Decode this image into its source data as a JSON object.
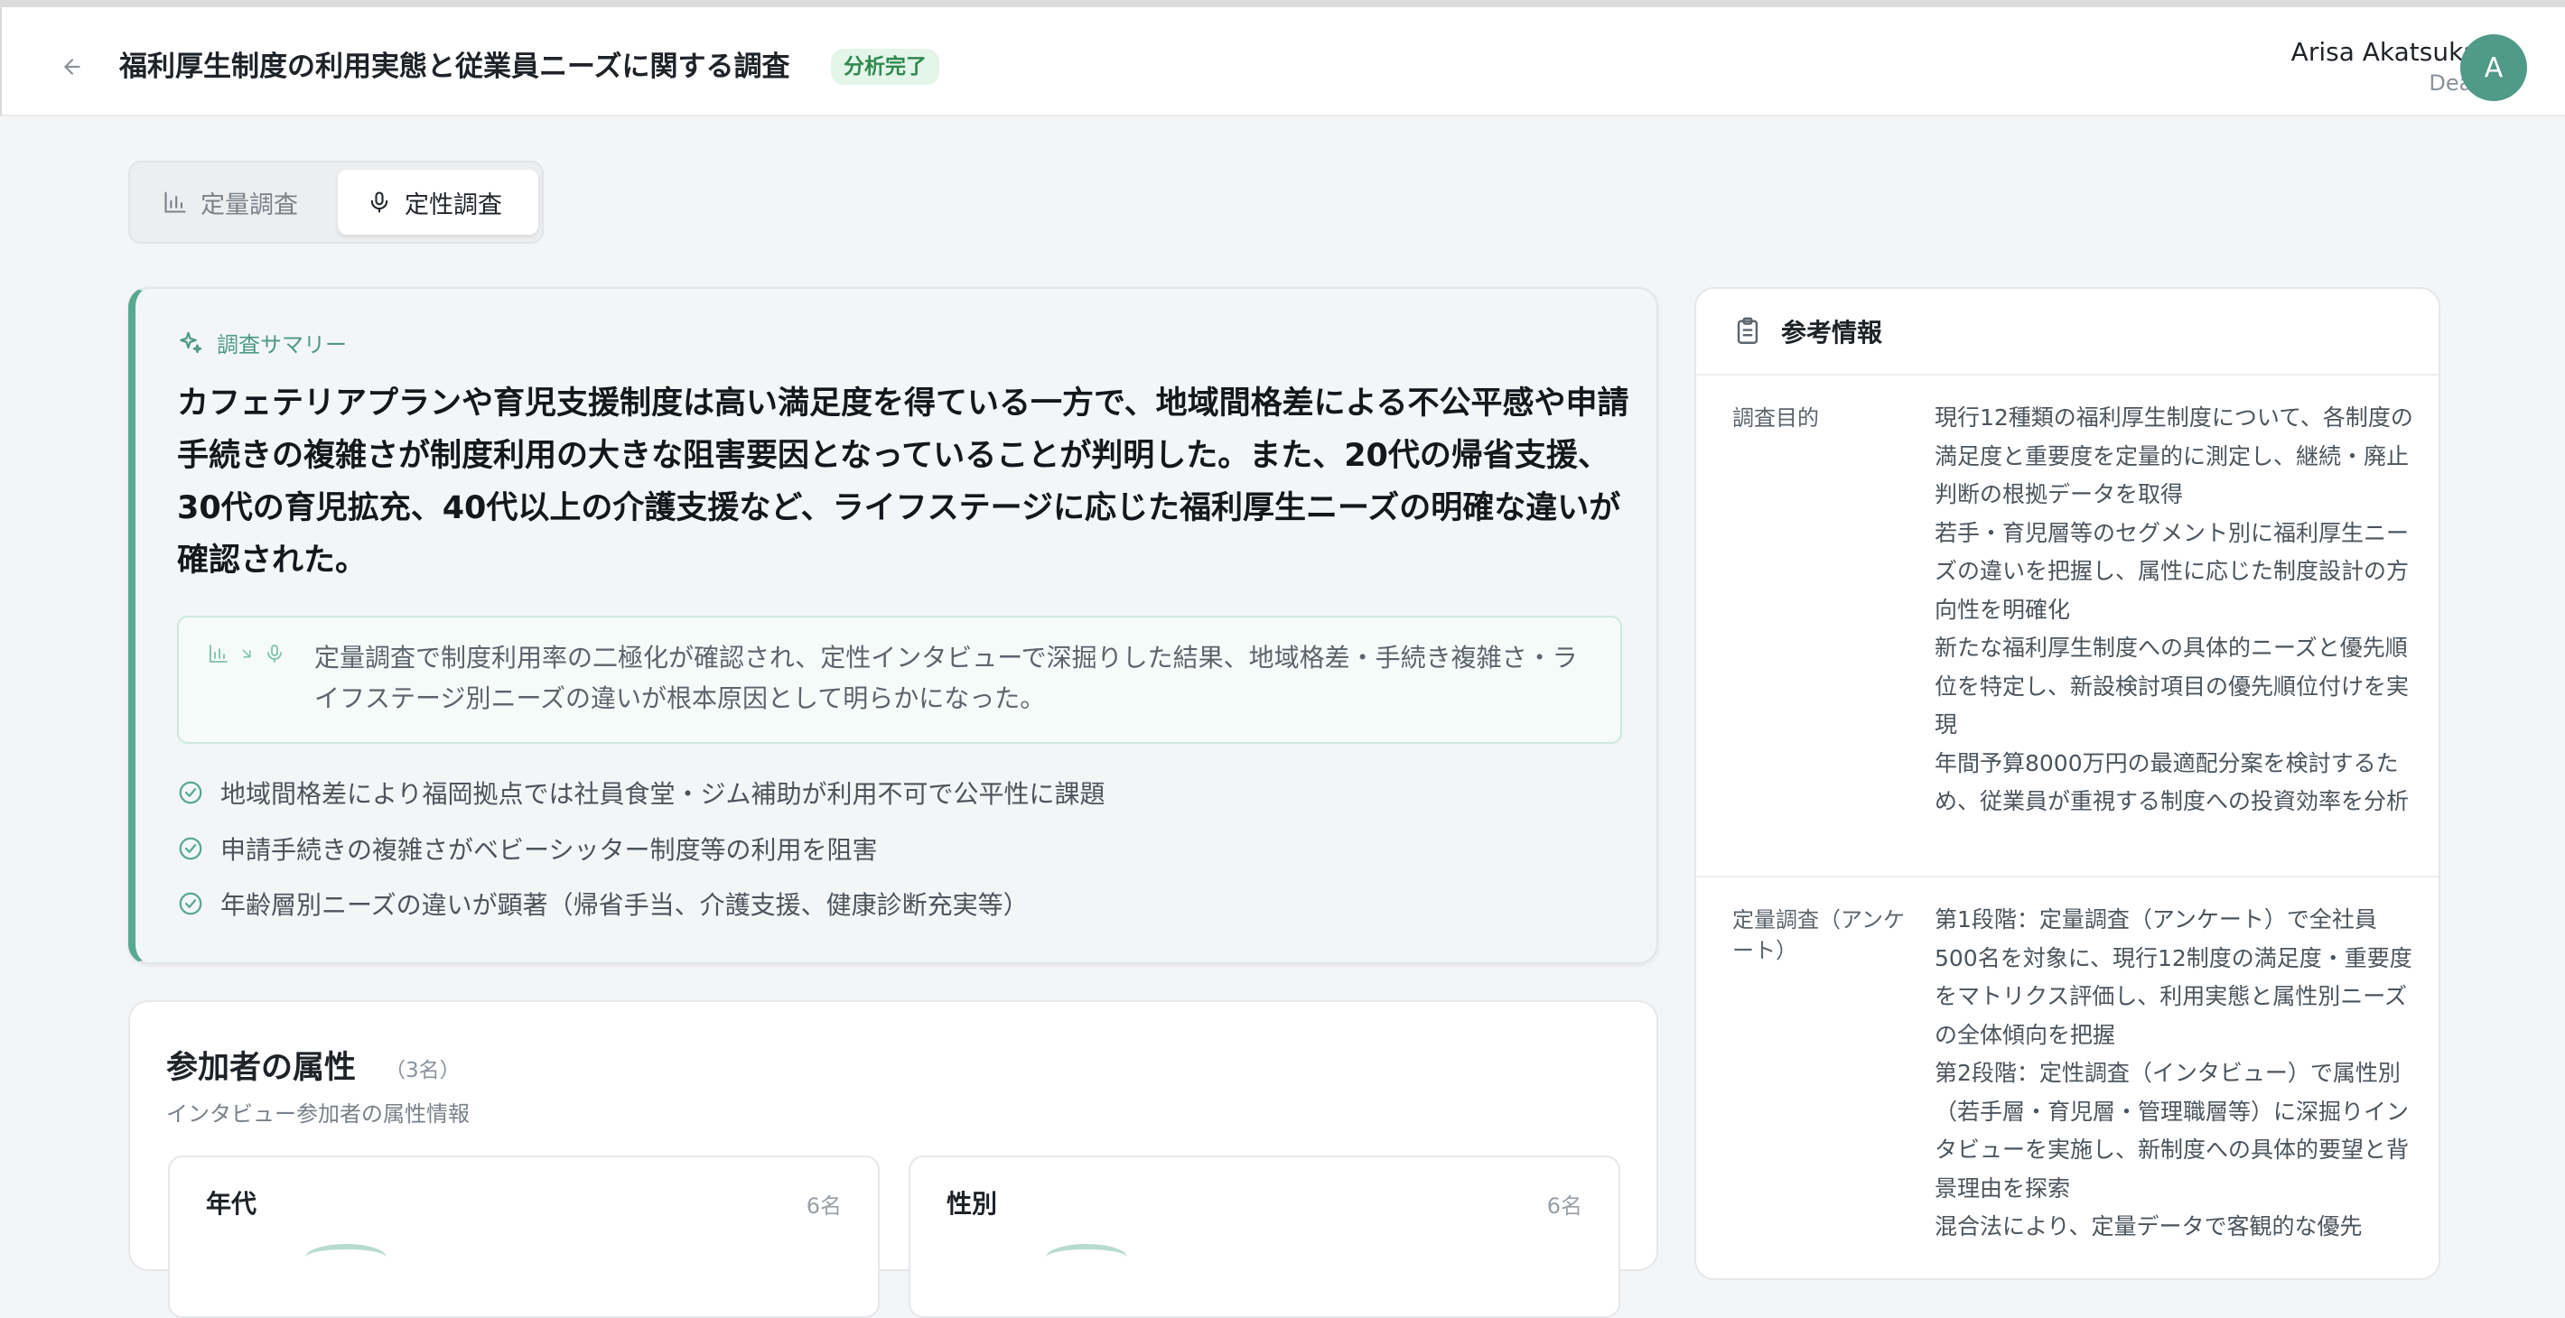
{
  "header": {
    "title": "福利厚生制度の利用実態と従業員ニーズに関する調査",
    "status": "分析完了",
    "user_name": "Arisa Akatsuka",
    "user_role": "Deal",
    "avatar_initial": "A",
    "back_icon": "arrow-left-icon"
  },
  "tabs": [
    {
      "label": "定量調査",
      "icon": "bar-chart-icon",
      "active": false
    },
    {
      "label": "定性調査",
      "icon": "microphone-icon",
      "active": true
    }
  ],
  "summary": {
    "label": "調査サマリー",
    "text": "カフェテリアプランや育児支援制度は高い満足度を得ている一方で、地域間格差による不公平感や申請手続きの複雑さが制度利用の大きな阻害要因となっていることが判明した。また、20代の帰省支援、30代の育児拡充、40代以上の介護支援など、ライフステージに応じた福利厚生ニーズの明確な違いが確認された。",
    "insight": "定量調査で制度利用率の二極化が確認され、定性インタビューで深掘りした結果、地域格差・手続き複雑さ・ライフステージ別ニーズの違いが根本原因として明らかになった。",
    "findings": [
      "地域間格差により福岡拠点では社員食堂・ジム補助が利用不可で公平性に課題",
      "申請手続きの複雑さがベビーシッター制度等の利用を阻害",
      "年齢層別ニーズの違いが顕著（帰省手当、介護支援、健康診断充実等）"
    ]
  },
  "attributes": {
    "title": "参加者の属性",
    "count": "（3名）",
    "subtitle": "インタビュー参加者の属性情報",
    "cards": [
      {
        "title": "年代",
        "count": "6名"
      },
      {
        "title": "性別",
        "count": "6名"
      }
    ]
  },
  "reference": {
    "title": "参考情報",
    "rows": [
      {
        "label": "調査目的",
        "values": [
          "現行12種類の福利厚生制度について、各制度の満足度と重要度を定量的に測定し、継続・廃止判断の根拠データを取得",
          "若手・育児層等のセグメント別に福利厚生ニーズの違いを把握し、属性に応じた制度設計の方向性を明確化",
          "新たな福利厚生制度への具体的ニーズと優先順位を特定し、新設検討項目の優先順位付けを実現",
          "年間予算8000万円の最適配分案を検討するため、従業員が重視する制度への投資効率を分析"
        ]
      },
      {
        "label": "定量調査（アンケート）",
        "values": [
          "第1段階：定量調査（アンケート）で全社員500名を対象に、現行12制度の満足度・重要度をマトリクス評価し、利用実態と属性別ニーズの全体傾向を把握",
          "第2段階：定性調査（インタビュー）で属性別（若手層・育児層・管理職層等）に深掘りインタビューを実施し、新制度への具体的要望と背景理由を探索",
          "混合法により、定量データで客観的な優先"
        ]
      }
    ]
  },
  "colors": {
    "accent": "#58a98f",
    "badge_bg": "#e4f5e9",
    "badge_text": "#2f8a4f",
    "avatar": "#4f9a88"
  }
}
